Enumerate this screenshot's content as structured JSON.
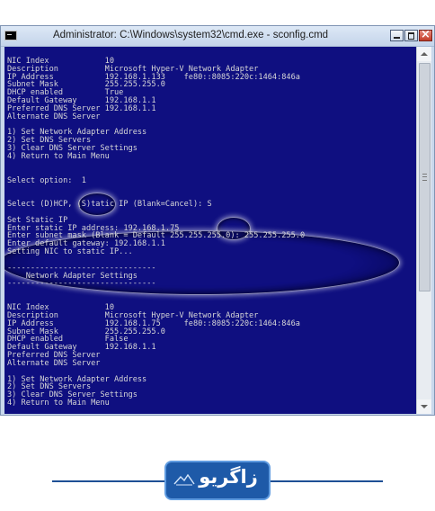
{
  "window": {
    "title": "Administrator: C:\\Windows\\system32\\cmd.exe - sconfig.cmd"
  },
  "console": {
    "lines": [
      "",
      "NIC Index            10",
      "Description          Microsoft Hyper-V Network Adapter",
      "IP Address           192.168.1.133    fe80::8085:220c:1464:846a",
      "Subnet Mask          255.255.255.0",
      "DHCP enabled         True",
      "Default Gateway      192.168.1.1",
      "Preferred DNS Server 192.168.1.1",
      "Alternate DNS Server",
      "",
      "1) Set Network Adapter Address",
      "2) Set DNS Servers",
      "3) Clear DNS Server Settings",
      "4) Return to Main Menu",
      "",
      "",
      "Select option:  1",
      "",
      "",
      "Select (D)HCP, (S)tatic IP (Blank=Cancel): S",
      "",
      "Set Static IP",
      "Enter static IP address: 192.168.1.75",
      "Enter subnet mask (Blank = Default 255.255.255.0): 255.255.255.0",
      "Enter default gateway: 192.168.1.1",
      "Setting NIC to static IP...",
      "",
      "--------------------------------",
      "    Network Adapter Settings",
      "--------------------------------",
      "",
      "",
      "NIC Index            10",
      "Description          Microsoft Hyper-V Network Adapter",
      "IP Address           192.168.1.75     fe80::8085:220c:1464:846a",
      "Subnet Mask          255.255.255.0",
      "DHCP enabled         False",
      "Default Gateway      192.168.1.1",
      "Preferred DNS Server",
      "Alternate DNS Server",
      "",
      "1) Set Network Adapter Address",
      "2) Set DNS Servers",
      "3) Clear DNS Server Settings",
      "4) Return to Main Menu",
      ""
    ]
  },
  "logo": {
    "text": "زاگریو"
  },
  "colors": {
    "console_bg": "#0f0f80",
    "console_text": "#d7d7d7",
    "logo_blue": "#1e5aa8"
  }
}
